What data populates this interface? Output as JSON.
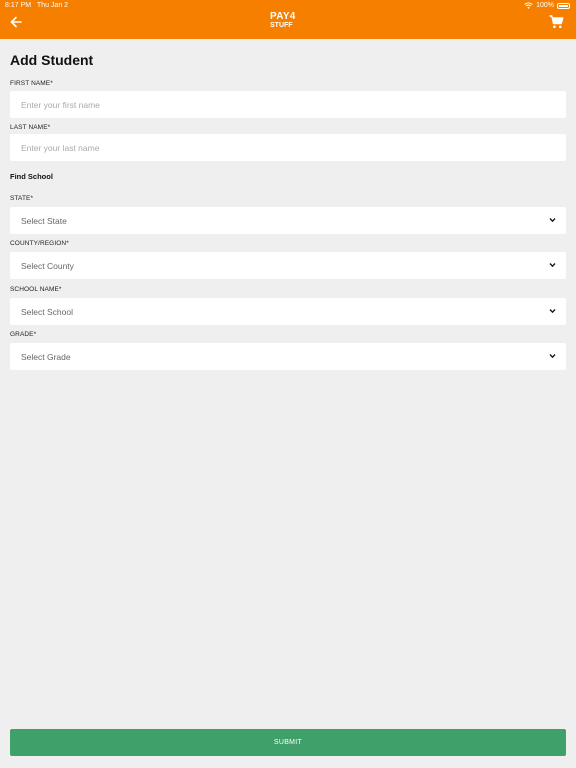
{
  "status_bar": {
    "time": "8:17 PM",
    "date": "Thu Jan 2",
    "battery": "100%"
  },
  "header": {
    "logo_top": "PAY4",
    "logo_bottom": "STUFF"
  },
  "page": {
    "title": "Add Student"
  },
  "form": {
    "first_name": {
      "label": "FIRST NAME*",
      "placeholder": "Enter your first name"
    },
    "last_name": {
      "label": "LAST NAME*",
      "placeholder": "Enter your last name"
    },
    "find_school": "Find School",
    "state": {
      "label": "STATE*",
      "value": "Select State"
    },
    "county": {
      "label": "COUNTY/REGION*",
      "value": "Select County"
    },
    "school": {
      "label": "SCHOOL NAME*",
      "value": "Select School"
    },
    "grade": {
      "label": "GRADE*",
      "value": "Select Grade"
    },
    "submit_label": "SUBMIT"
  },
  "colors": {
    "header": "#f77f00",
    "submit": "#3fa06a",
    "background": "#efefef"
  }
}
